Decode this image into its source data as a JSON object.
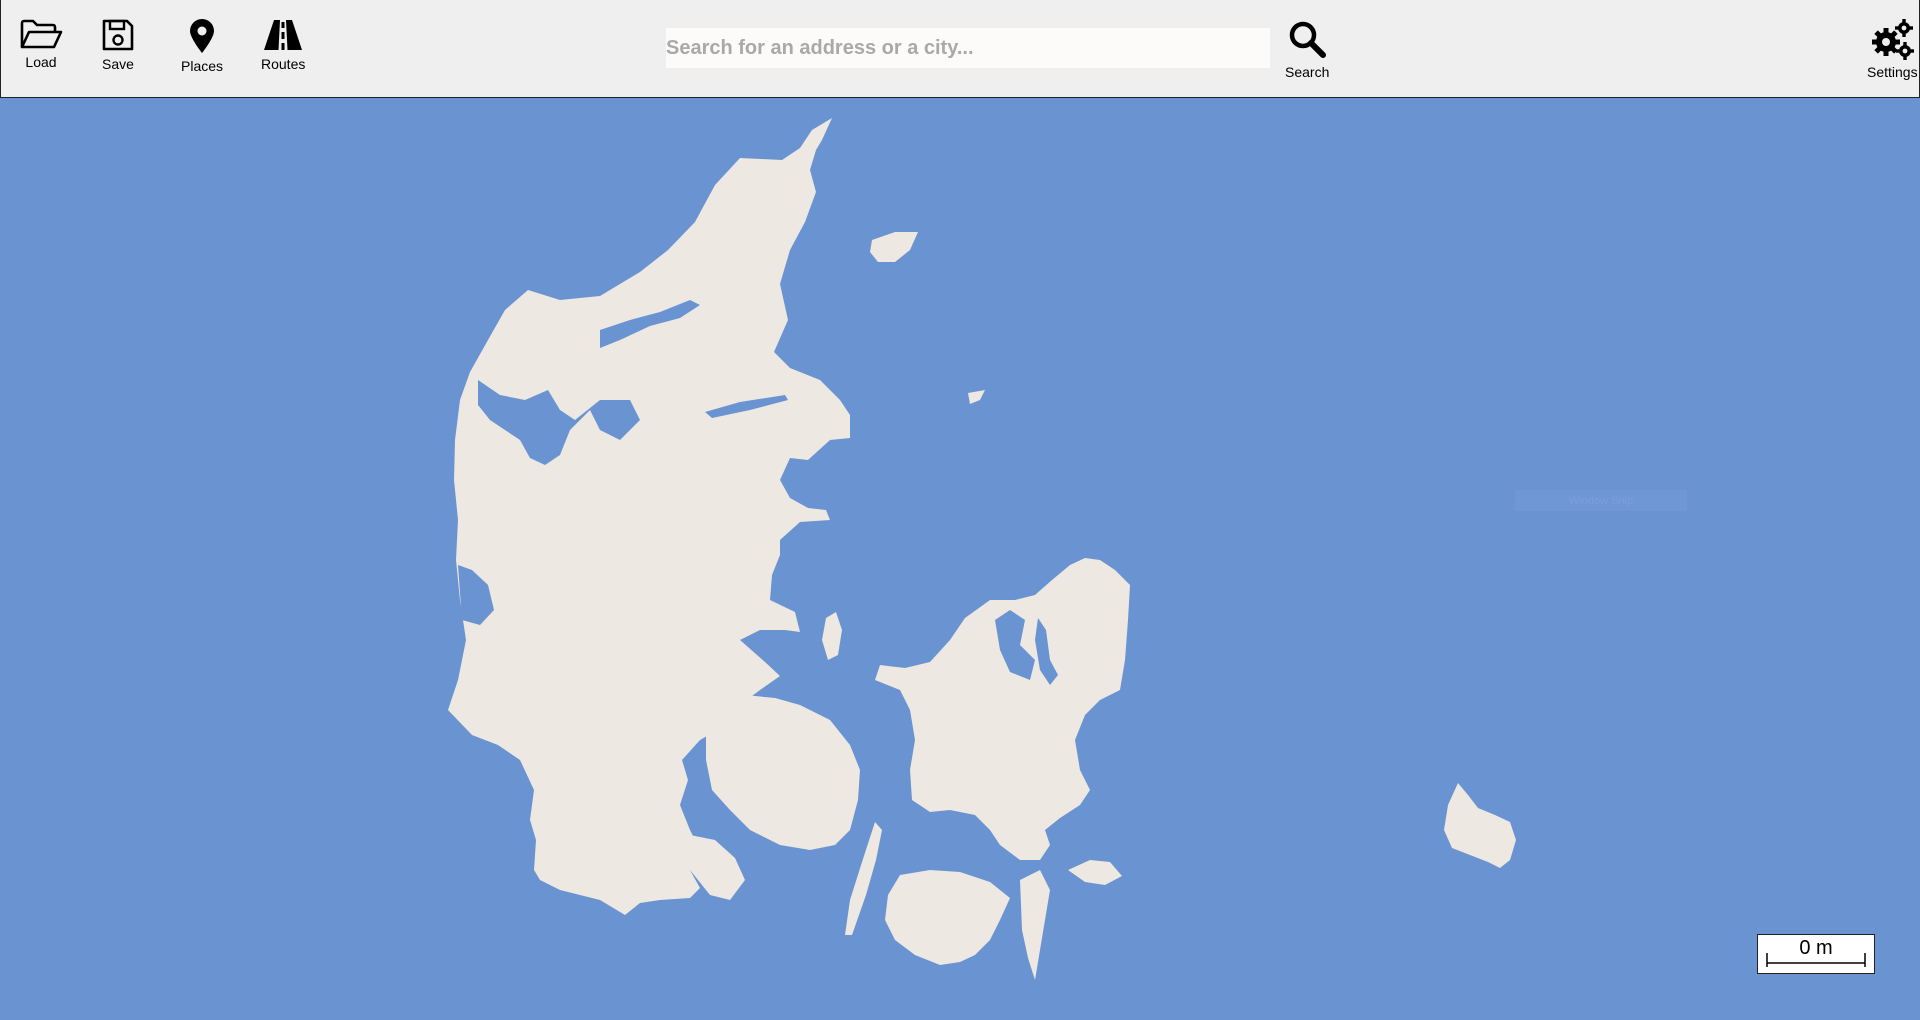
{
  "toolbar": {
    "load_label": "Load",
    "save_label": "Save",
    "places_label": "Places",
    "routes_label": "Routes",
    "search_label": "Search",
    "settings_label": "Settings"
  },
  "search": {
    "placeholder": "Search for an address or a city...",
    "value": ""
  },
  "map": {
    "water_color": "#6a93d1",
    "land_color": "#ede8e1",
    "overlay_text": "Window Snip",
    "scale_label": "0 m"
  },
  "icons": [
    "folder-open-icon",
    "floppy-disk-icon",
    "map-pin-icon",
    "road-icon",
    "search-icon",
    "gears-icon"
  ]
}
